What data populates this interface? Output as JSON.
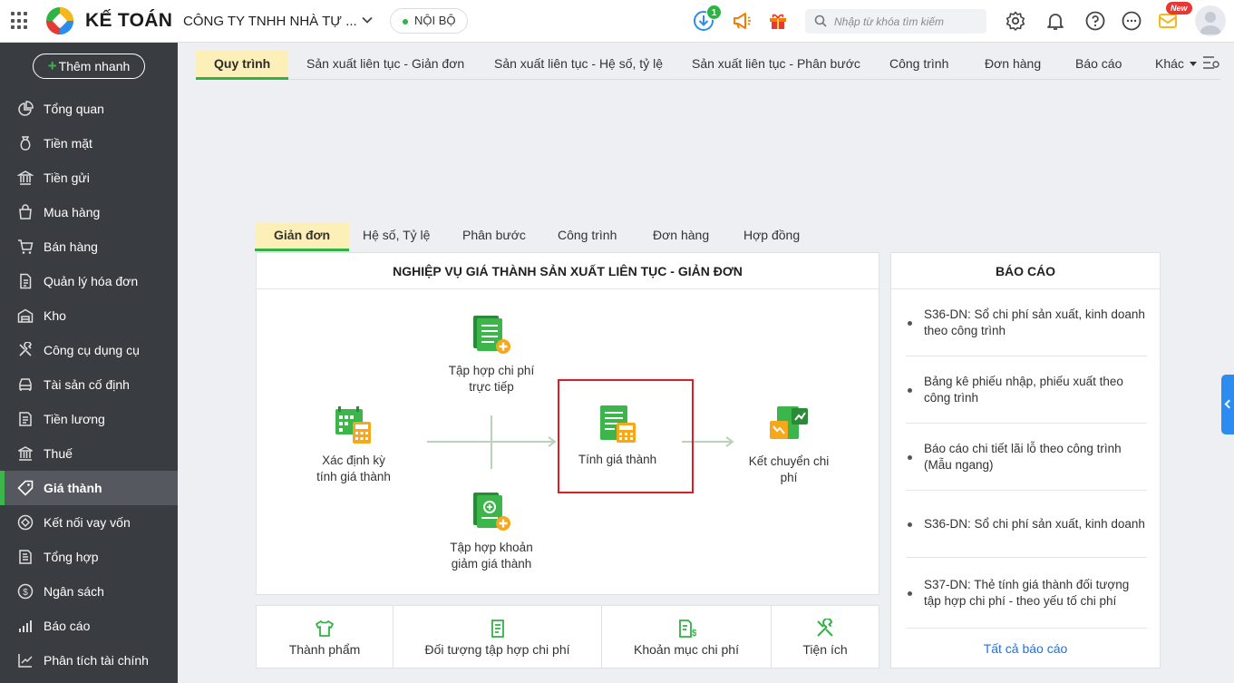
{
  "header": {
    "brand": "KẾ TOÁN",
    "company": "CÔNG TY TNHH NHÀ TỰ ...",
    "env": "NỘI BỘ",
    "download_count": "1",
    "search_placeholder": "Nhập từ khóa tìm kiếm",
    "new_label": "New"
  },
  "sidebar": {
    "quick_add": "Thêm nhanh",
    "items": [
      {
        "label": "Tổng quan",
        "icon": "pie-chart-icon"
      },
      {
        "label": "Tiền mặt",
        "icon": "money-bag-icon"
      },
      {
        "label": "Tiền gửi",
        "icon": "bank-icon"
      },
      {
        "label": "Mua hàng",
        "icon": "shopping-bag-icon"
      },
      {
        "label": "Bán hàng",
        "icon": "cart-icon"
      },
      {
        "label": "Quản lý hóa đơn",
        "icon": "invoice-icon"
      },
      {
        "label": "Kho",
        "icon": "warehouse-icon"
      },
      {
        "label": "Công cụ dụng cụ",
        "icon": "tools-icon"
      },
      {
        "label": "Tài sản cố định",
        "icon": "car-icon"
      },
      {
        "label": "Tiền lương",
        "icon": "payroll-icon"
      },
      {
        "label": "Thuế",
        "icon": "tax-building-icon"
      },
      {
        "label": "Giá thành",
        "icon": "price-tag-icon",
        "active": true
      },
      {
        "label": "Kết nối vay vốn",
        "icon": "loan-icon"
      },
      {
        "label": "Tổng hợp",
        "icon": "summary-icon"
      },
      {
        "label": "Ngân sách",
        "icon": "budget-icon"
      },
      {
        "label": "Báo cáo",
        "icon": "bar-chart-icon"
      },
      {
        "label": "Phân tích tài chính",
        "icon": "analysis-icon"
      }
    ]
  },
  "module_tabs": [
    "Quy trình",
    "Sản xuất liên tục - Giản đơn",
    "Sản xuất liên tục - Hệ số, tỷ lệ",
    "Sản xuất liên tục - Phân bước",
    "Công trình",
    "Đơn hàng",
    "Báo cáo",
    "Khác"
  ],
  "sub_tabs": [
    "Giản đơn",
    "Hệ số, Tỷ lệ",
    "Phân bước",
    "Công trình",
    "Đơn hàng",
    "Hợp đồng"
  ],
  "process": {
    "title": "NGHIỆP VỤ GIÁ THÀNH SẢN XUẤT LIÊN TỤC - GIẢN ĐƠN",
    "node_period": [
      "Xác định kỳ",
      "tính giá thành"
    ],
    "node_direct": [
      "Tập hợp chi phí",
      "trực tiếp"
    ],
    "node_calc": "Tính giá thành",
    "node_reduce": [
      "Tập hợp khoản",
      "giảm giá thành"
    ],
    "node_transfer": [
      "Kết chuyển chi",
      "phí"
    ]
  },
  "tools": [
    "Thành phẩm",
    "Đối tượng tập hợp chi phí",
    "Khoản mục chi phí",
    "Tiện ích"
  ],
  "reports": {
    "title": "BÁO CÁO",
    "items": [
      "S36-DN: Sổ chi phí sản xuất, kinh doanh theo công trình",
      "Bảng kê phiếu nhập, phiếu xuất theo công trình",
      "Báo cáo chi tiết lãi lỗ theo công trình (Mẫu ngang)",
      "S36-DN: Sổ chi phí sản xuất, kinh doanh",
      "S37-DN: Thẻ tính giá thành đối tượng tập hợp chi phí - theo yếu tố chi phí"
    ],
    "all_link": "Tất cả báo cáo"
  },
  "colors": {
    "accent_green": "#2fb344",
    "active_tab_bg": "#fcefb7",
    "sidebar_bg": "#393c41",
    "highlight_red": "#d81f26",
    "link_blue": "#1a73e8"
  }
}
